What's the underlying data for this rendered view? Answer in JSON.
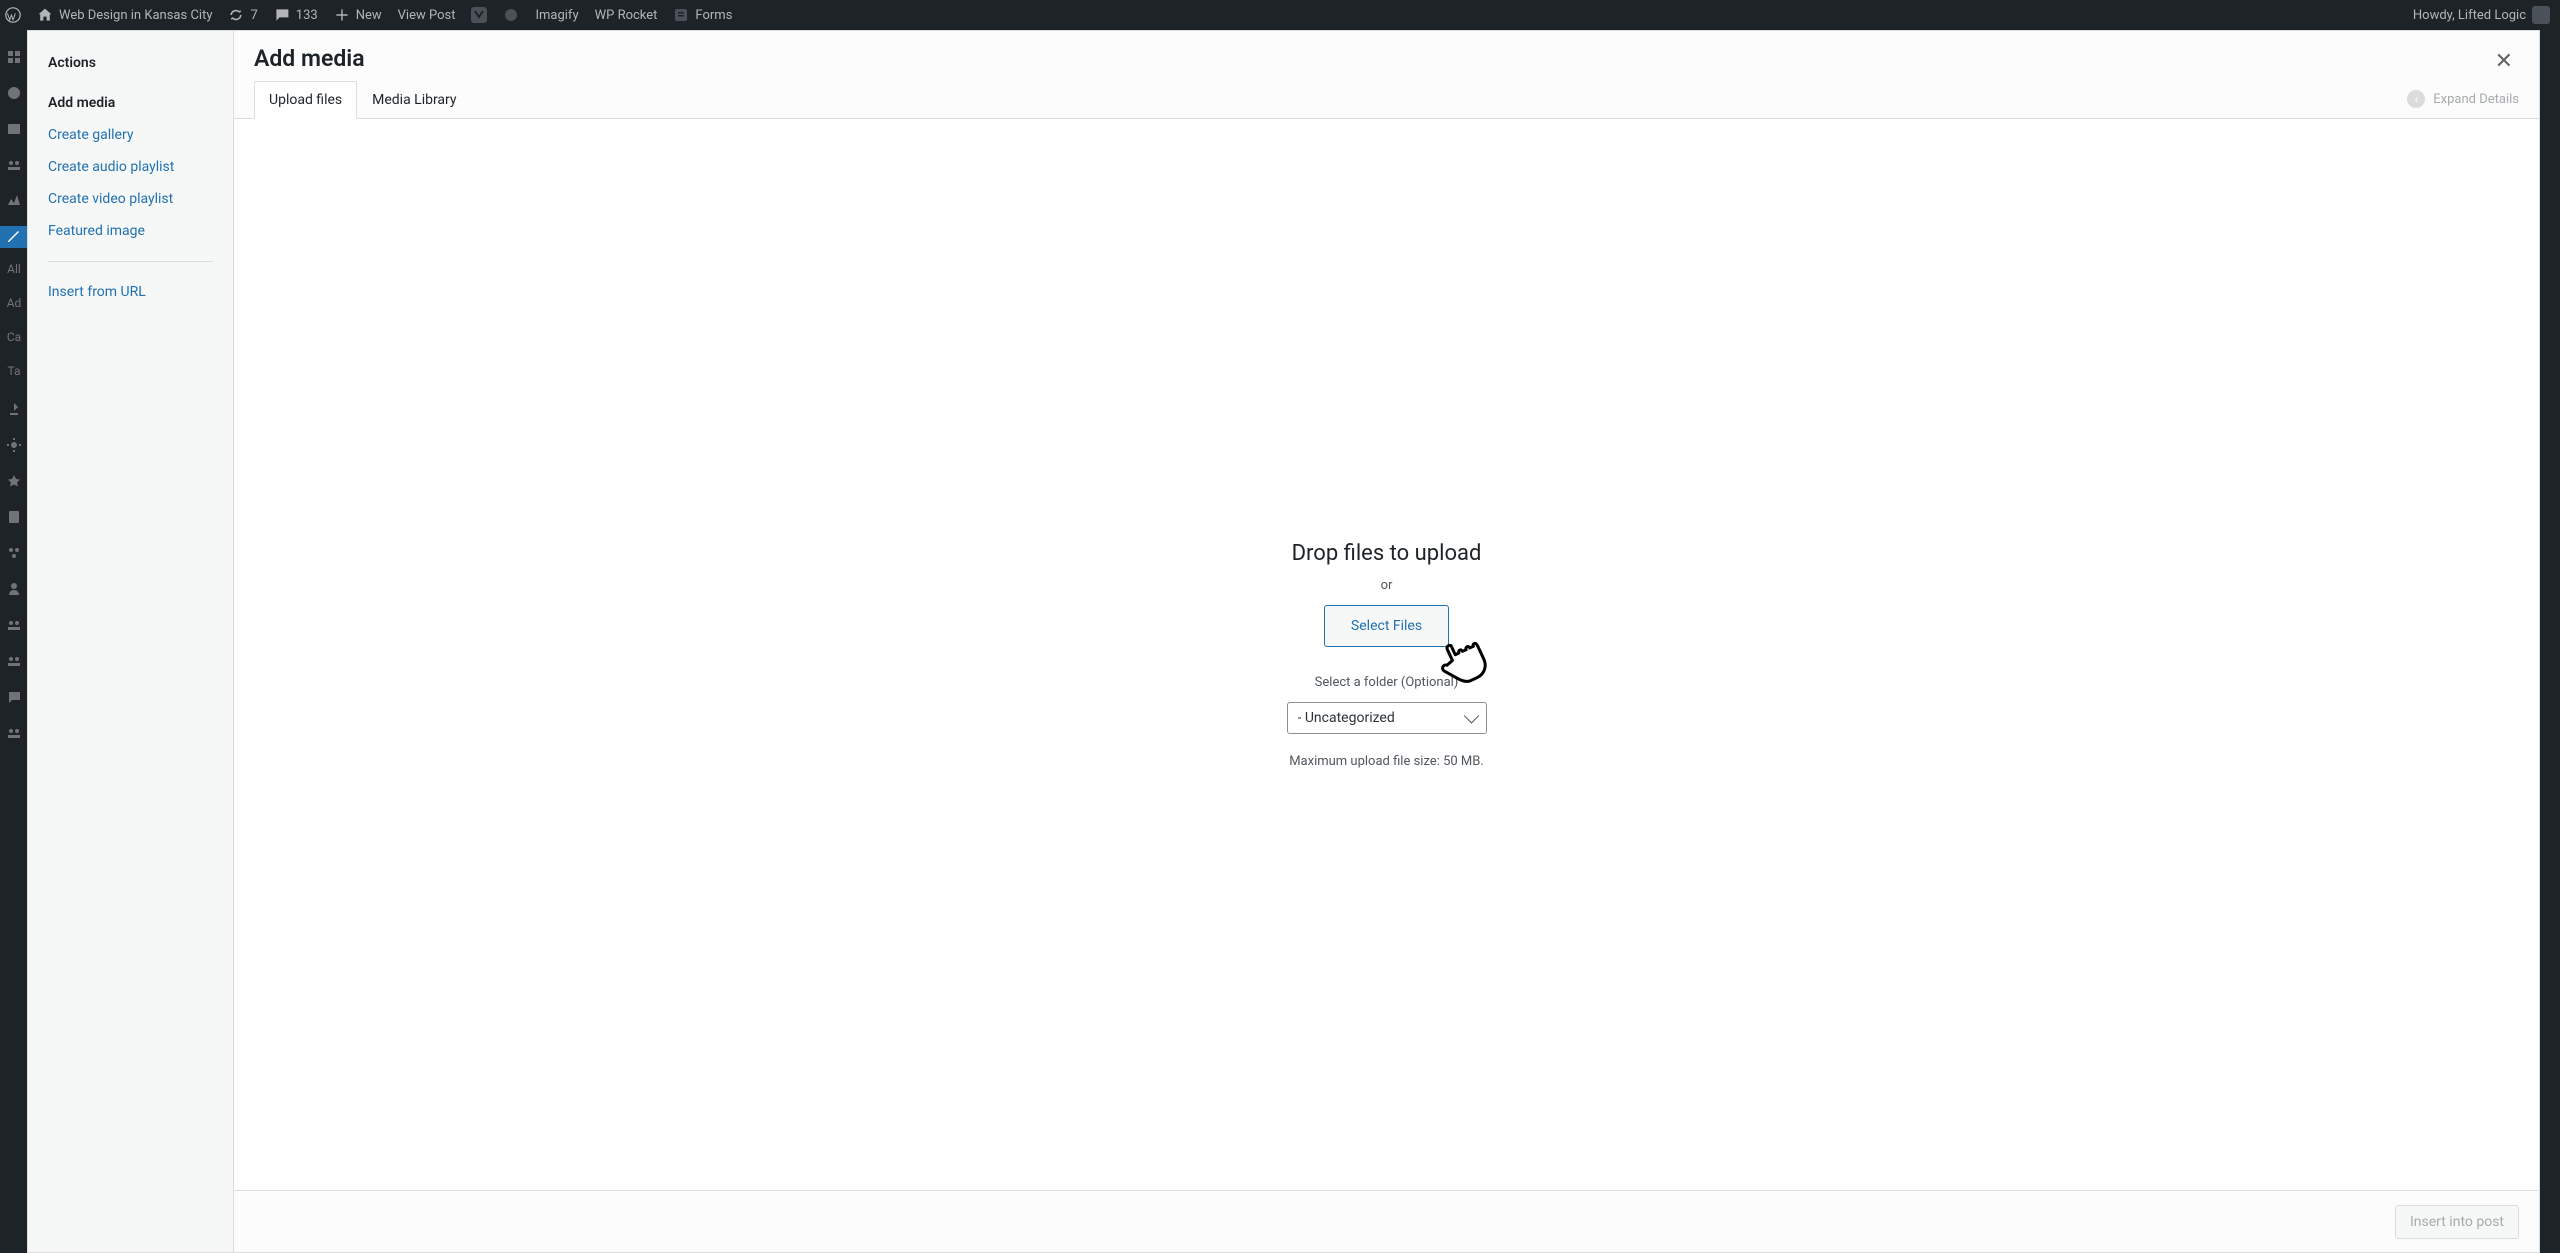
{
  "adminbar": {
    "site_title": "Web Design in Kansas City",
    "updates_count": "7",
    "comments_count": "133",
    "new_label": "New",
    "view_post": "View Post",
    "imagify": "Imagify",
    "wp_rocket": "WP Rocket",
    "forms": "Forms",
    "howdy": "Howdy, Lifted Logic"
  },
  "left_menu_items": [
    "All",
    "Ad",
    "Ca",
    "Ta"
  ],
  "modal": {
    "title": "Add media",
    "close": "×",
    "expand_details": "Expand Details"
  },
  "sidebar": {
    "actions_heading": "Actions",
    "items": [
      {
        "label": "Add media",
        "active": true
      },
      {
        "label": "Create gallery"
      },
      {
        "label": "Create audio playlist"
      },
      {
        "label": "Create video playlist"
      },
      {
        "label": "Featured image"
      }
    ],
    "insert_url": "Insert from URL"
  },
  "tabs": {
    "upload": "Upload files",
    "library": "Media Library"
  },
  "dropzone": {
    "title": "Drop files to upload",
    "or": "or",
    "select_files": "Select Files",
    "folder_label": "Select a folder (Optional)",
    "folder_value": "- Uncategorized",
    "max_size": "Maximum upload file size: 50 MB."
  },
  "footer": {
    "insert": "Insert into post"
  }
}
